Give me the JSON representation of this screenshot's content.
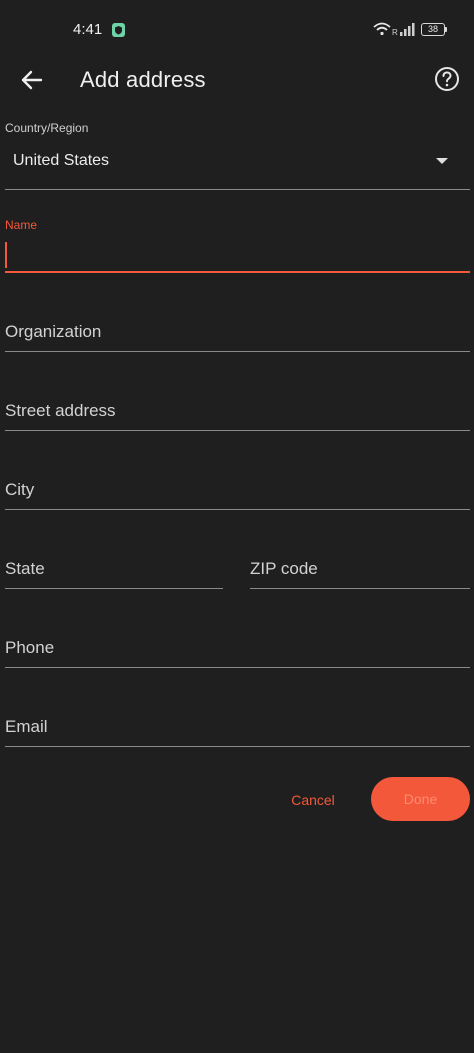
{
  "status_bar": {
    "time": "4:41",
    "battery": "38",
    "signal_letter": "R"
  },
  "appbar": {
    "title": "Add address"
  },
  "form": {
    "country_label": "Country/Region",
    "country_value": "United States",
    "name_label": "Name",
    "name_value": "",
    "organization_placeholder": "Organization",
    "street_placeholder": "Street address",
    "city_placeholder": "City",
    "state_placeholder": "State",
    "zip_placeholder": "ZIP code",
    "phone_placeholder": "Phone",
    "email_placeholder": "Email"
  },
  "actions": {
    "cancel": "Cancel",
    "done": "Done"
  },
  "colors": {
    "accent": "#f4583b",
    "background": "#1f1f1f"
  }
}
